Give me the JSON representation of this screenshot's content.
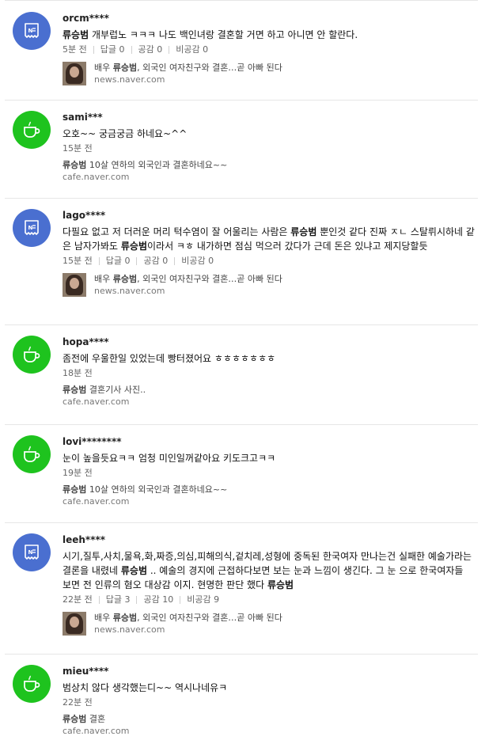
{
  "comments": [
    {
      "type": "news",
      "nick": "orcm****",
      "text_bold": "류승범",
      "text_rest": " 개부럽노 ㅋㅋㅋ 나도 백인녀랑 결혼할 거면 하고 아니면 안 할란다.",
      "time": "5분 전",
      "reply": "답글 0",
      "like": "공감 0",
      "dislike": "비공감 0",
      "source_pre": "배우 ",
      "source_bold": "류승범",
      "source_post": ", 외국인 여자친구와 결혼…곧 아빠 된다",
      "domain": "news.naver.com"
    },
    {
      "type": "cafe",
      "nick": "sami***",
      "text": "오호~~ 궁금궁금 하네요~^^",
      "time": "15분 전",
      "source_bold": "류승범",
      "source_post": " 10살 연하의 외국인과 결혼하네요~~",
      "domain": "cafe.naver.com"
    },
    {
      "type": "news",
      "nick": "lago****",
      "text_html_parts": [
        "다필요 없고 저 더러운 머리 턱수염이 잘 어울리는 사람은 ",
        "류승범",
        " 뿐인것 같다 진짜 ㅈㄴ 스탈뤼시하네 같은 남자가봐도 ",
        "류승범",
        "이라서 ㅋㅎ 내가하면 점심 먹으러 갔다가 근데 돈은 있냐고 제지당할듯"
      ],
      "time": "15분 전",
      "reply": "답글 0",
      "like": "공감 0",
      "dislike": "비공감 0",
      "source_pre": "배우 ",
      "source_bold": "류승범",
      "source_post": ", 외국인 여자친구와 결혼…곧 아빠 된다",
      "domain": "news.naver.com"
    },
    {
      "type": "cafe",
      "nick": "hopa****",
      "text": "좀전에 우울한일 있었는데 빵터졌어요 ㅎㅎㅎㅎㅎㅎㅎ",
      "time": "18분 전",
      "source_bold": "류승범",
      "source_post": " 결혼기사 사진..",
      "domain": "cafe.naver.com"
    },
    {
      "type": "cafe",
      "nick": "lovi********",
      "text": "눈이 높을듯요ㅋㅋ 엄청 미인일꺼같아요 키도크고ㅋㅋ",
      "time": "19분 전",
      "source_bold": "류승범",
      "source_post": " 10살 연하의 외국인과 결혼하네요~~",
      "domain": "cafe.naver.com"
    },
    {
      "type": "news",
      "nick": "leeh****",
      "text_html_parts": [
        "시기,질투,사치,물욕,화,짜증,의심,피해의식,겉치레,성형에 중독된 한국여자 만나는건 실패한 예술가라는 결론을 내렸네 ",
        "류승범",
        " .. 예술의 경지에 근접하다보면 보는 눈과 느낌이 생긴다. 그 눈 으로 한국여자들 보면 전 인류의 혐오 대상감 이지. 현명한 판단 했다 ",
        "류승범",
        ""
      ],
      "time": "22분 전",
      "reply": "답글 3",
      "like": "공감 10",
      "dislike": "비공감 9",
      "source_pre": "배우 ",
      "source_bold": "류승범",
      "source_post": ", 외국인 여자친구와 결혼…곧 아빠 된다",
      "domain": "news.naver.com"
    },
    {
      "type": "cafe",
      "nick": "mieu****",
      "text": "범상치 않다 생각했는디~~ 역시나네유ㅋ",
      "time": "22분 전",
      "source_bold": "류승범",
      "source_post": " 결혼",
      "domain": "cafe.naver.com"
    }
  ],
  "colors": {
    "news_badge": "#4a6fd0",
    "cafe_badge": "#1ec31e"
  },
  "icons": {
    "news": "newspaper-icon",
    "cafe": "coffee-cup-icon"
  }
}
